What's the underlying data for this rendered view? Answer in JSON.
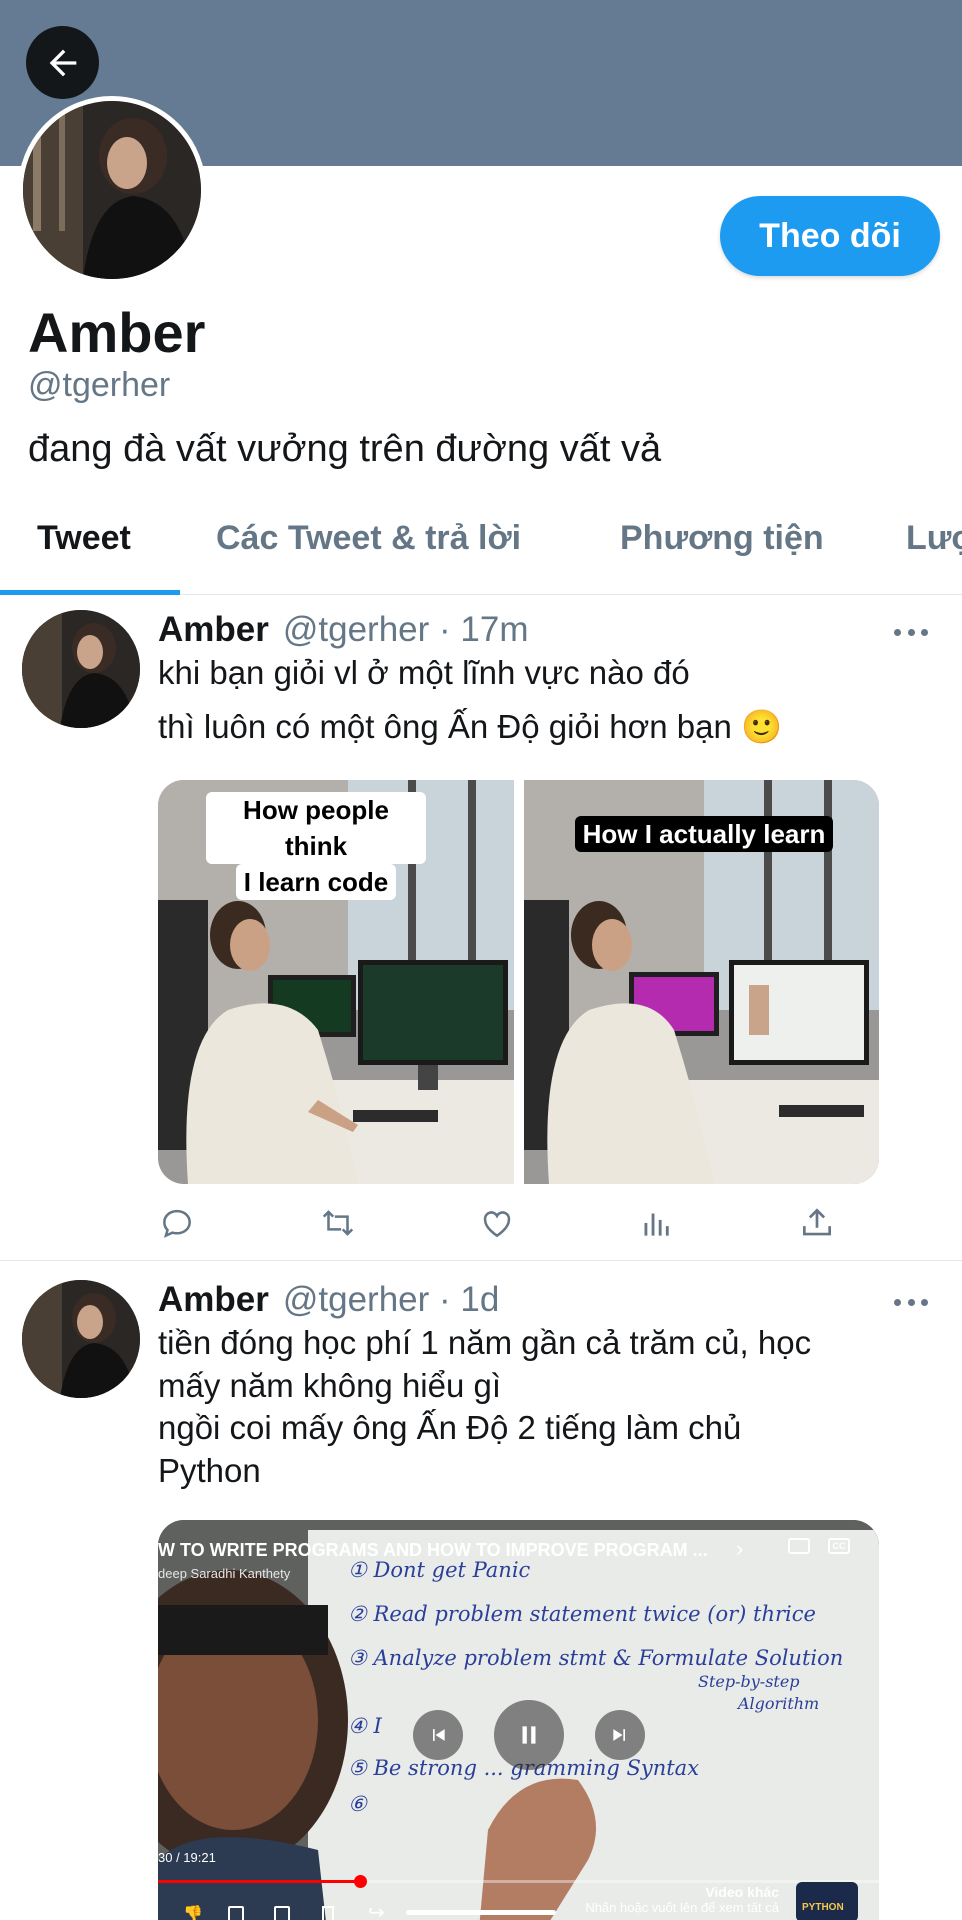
{
  "profile": {
    "name": "Amber",
    "handle": "@tgerher",
    "bio": "đang đà vất vưởng trên đường vất vả",
    "follow_label": "Theo dõi",
    "banner_color": "#657b93",
    "accent_color": "#1d9bf0"
  },
  "tabs": [
    {
      "label": "Tweet",
      "active": true
    },
    {
      "label": "Các Tweet & trả lời",
      "active": false
    },
    {
      "label": "Phương tiện",
      "active": false
    },
    {
      "label": "Lượ",
      "active": false
    }
  ],
  "tweets": [
    {
      "name": "Amber",
      "meta": "@tgerher · 17m",
      "lines": [
        "khi bạn giỏi vl ở một lĩnh vực nào đó",
        "thì luôn có một ông Ấn Độ giỏi hơn bạn 🙂"
      ],
      "media_captions": {
        "left_line1": "How people think",
        "left_line2": "I learn code",
        "right": "How I actually learn"
      },
      "actions": [
        "reply-icon",
        "retweet-icon",
        "like-icon",
        "analytics-icon",
        "share-icon"
      ]
    },
    {
      "name": "Amber",
      "meta": "@tgerher · 1d",
      "lines": [
        "tiền đóng học phí 1 năm gần cả trăm củ, học",
        "mấy năm không hiểu gì",
        "ngồi coi mấy ông Ấn Độ 2 tiếng làm chủ",
        "Python"
      ],
      "video": {
        "title": "W TO WRITE PROGRAMS AND HOW TO IMPROVE PROGRAM ...",
        "channel": "deep Saradhi Kanthety",
        "time": "30 / 19:21",
        "more_videos_label": "Video khác",
        "more_videos_hint": "Nhấn hoặc vuốt lên để xem tất cả",
        "thumb_text_line1": "PYTHON",
        "board_lines": [
          "① Dont get Panic",
          "② Read problem statement twice (or) thrice",
          "③ Analyze problem stmt & Formulate Solution",
          "Step-by-step",
          "Algorithm",
          "④ I",
          "⑤ Be strong ... gramming Syntax",
          "⑥"
        ],
        "progress": 0.28
      }
    }
  ]
}
